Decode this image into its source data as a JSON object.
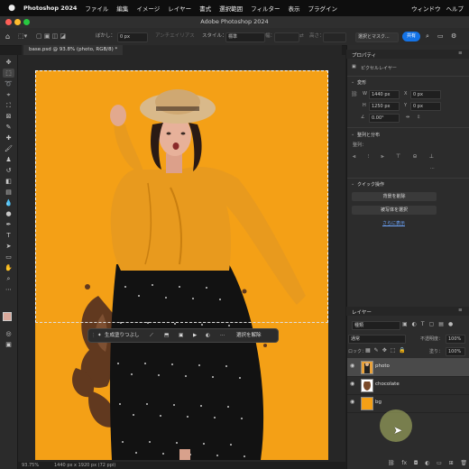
{
  "menubar": {
    "apple": "",
    "items": [
      "Photoshop 2024",
      "ファイル",
      "編集",
      "イメージ",
      "レイヤー",
      "書式",
      "選択範囲",
      "フィルター",
      "表示",
      "プラグイン"
    ],
    "right": [
      "ウィンドウ",
      "ヘルプ"
    ]
  },
  "window": {
    "title": "Adobe Photoshop 2024"
  },
  "options_bar": {
    "feather_label": "ぼかし：",
    "feather_value": "0 px",
    "antialias_label": "アンチエイリアス",
    "style_label": "スタイル：",
    "style_value": "標準",
    "width_label": "幅：",
    "height_label": "高さ：",
    "select_mask": "選択とマスク...",
    "share": "共有"
  },
  "document": {
    "tab": "base.psd @ 93.8% (photo, RGB/8) *"
  },
  "context_bar": {
    "generative_fill": "生成塗りつぶし",
    "deselect": "選択を解除"
  },
  "status": {
    "zoom": "93.75%",
    "info": "1440 px x 1920 px (72 ppi)"
  },
  "properties": {
    "tab": "プロパティ",
    "layer_type": "ピクセルレイヤー",
    "transform_header": "変形",
    "w_label": "W",
    "w_value": "1440 px",
    "h_label": "H",
    "h_value": "1250 px",
    "x_label": "X",
    "x_value": "0 px",
    "y_label": "Y",
    "y_value": "0 px",
    "angle": "0.00°",
    "align_header": "整列と分布",
    "align_label": "整列：",
    "quick_header": "クイック操作",
    "remove_bg": "背景を削除",
    "select_subject": "被写体を選択",
    "more": "さらに表示"
  },
  "layers": {
    "tab": "レイヤー",
    "filter_kind": "種類",
    "blend_mode": "通常",
    "opacity_label": "不透明度：",
    "opacity_value": "100%",
    "lock_label": "ロック：",
    "fill_label": "塗り：",
    "fill_value": "100%",
    "items": [
      {
        "name": "photo",
        "color": "#e9a23b"
      },
      {
        "name": "chocolate",
        "color": "#7a4a2a"
      },
      {
        "name": "bg",
        "color": "#f4a016"
      }
    ]
  },
  "colors": {
    "accent": "#1473e6",
    "canvas_bg": "#f4a016",
    "blouse": "#e89a1e"
  }
}
